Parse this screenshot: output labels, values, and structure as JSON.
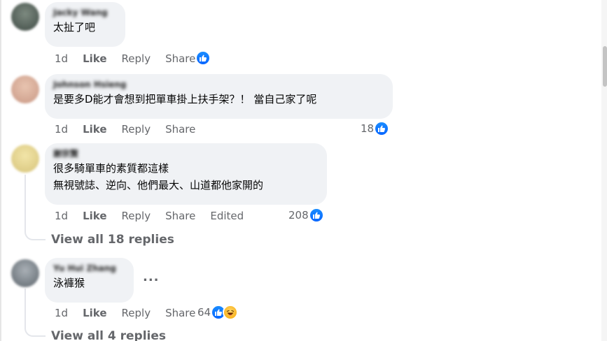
{
  "comments": [
    {
      "author": "Jacky Wang",
      "lines": [
        "太扯了吧"
      ],
      "actions": {
        "time": "1d",
        "like": "Like",
        "reply": "Reply",
        "share": "Share",
        "edited": ""
      },
      "reactions": {
        "count": "",
        "types": [
          "like"
        ]
      }
    },
    {
      "author": "Johnson Hsieng",
      "lines": [
        "是要多D能才會想到把單車掛上扶手架？！ 當自己家了呢"
      ],
      "actions": {
        "time": "1d",
        "like": "Like",
        "reply": "Reply",
        "share": "Share",
        "edited": ""
      },
      "reactions": {
        "count": "18",
        "types": [
          "like"
        ]
      }
    },
    {
      "author": "謝宗賢",
      "lines": [
        "很多騎單車的素質都這樣",
        "無視號誌、逆向、他們最大、山道都他家開的"
      ],
      "actions": {
        "time": "1d",
        "like": "Like",
        "reply": "Reply",
        "share": "Share",
        "edited": "Edited"
      },
      "reactions": {
        "count": "208",
        "types": [
          "like"
        ]
      },
      "view_replies": "View all 18 replies"
    },
    {
      "author": "Yu Hui Zhang",
      "lines": [
        "泳褲猴"
      ],
      "actions": {
        "time": "1d",
        "like": "Like",
        "reply": "Reply",
        "share": "Share",
        "edited": ""
      },
      "reactions": {
        "count": "64",
        "types": [
          "like",
          "haha"
        ]
      },
      "more_label": "...",
      "view_replies": "View all 4 replies"
    }
  ],
  "colors": {
    "like_blue": "#0866ff",
    "bubble_bg": "#f0f2f5",
    "meta_gray": "#65676b"
  },
  "icons": {
    "like": "thumbs-up-icon",
    "haha": "laughing-face-icon",
    "more": "more-options-icon"
  }
}
